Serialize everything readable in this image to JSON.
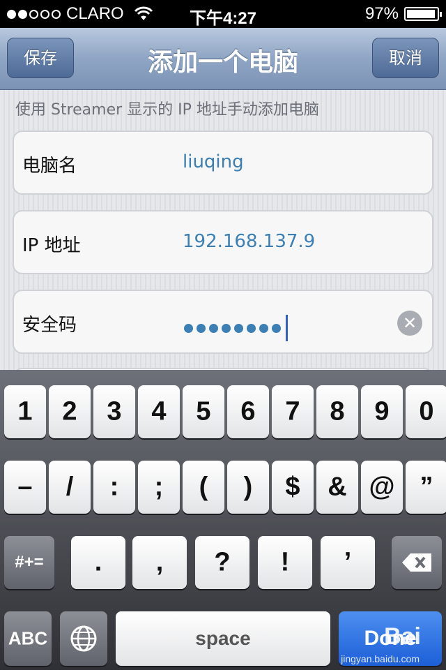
{
  "status": {
    "carrier": "CLARO",
    "time": "下午4:27",
    "battery": "97%"
  },
  "nav": {
    "title": "添加一个电脑",
    "save_label": "保存",
    "cancel_label": "取消"
  },
  "hint": "使用 Streamer 显示的 IP 地址手动添加电脑",
  "fields": [
    {
      "label": "电脑名",
      "value": "liuqing"
    },
    {
      "label": "IP 地址",
      "value": "192.168.137.9"
    },
    {
      "label": "安全码",
      "masked_length": 8
    }
  ],
  "keyboard": {
    "row1": [
      "1",
      "2",
      "3",
      "4",
      "5",
      "6",
      "7",
      "8",
      "9",
      "0"
    ],
    "row2": [
      "–",
      "/",
      ":",
      ";",
      "(",
      ")",
      "$",
      "&",
      "@",
      "”"
    ],
    "row3": [
      "#+=",
      ".",
      ",",
      "?",
      "!",
      "’"
    ],
    "abc_label": "ABC",
    "space_label": "space",
    "done_label": "Done",
    "globe_icon": "globe-icon",
    "delete_icon": "delete-icon"
  },
  "watermark": {
    "logo": "Bai",
    "url": "jingyan.baidu.com"
  }
}
